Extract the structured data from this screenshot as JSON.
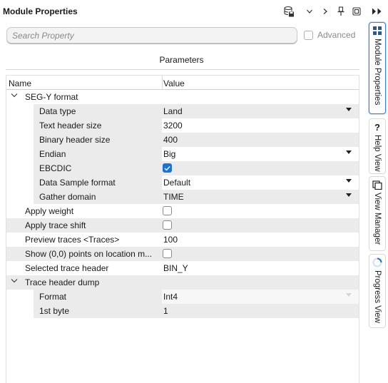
{
  "panel": {
    "title": "Module Properties",
    "search_placeholder": "Search Property",
    "advanced_label": "Advanced",
    "advanced_checked": false,
    "section_title": "Parameters"
  },
  "toolbar_icons": [
    "save-module-icon",
    "chevron-down-icon",
    "chevron-right-icon",
    "pin-icon",
    "popout-icon"
  ],
  "grid": {
    "columns": {
      "name": "Name",
      "value": "Value"
    },
    "rows": [
      {
        "id": "segy-format",
        "label": "SEG-Y format",
        "group": true,
        "expanded": true
      },
      {
        "id": "data-type",
        "label": "Data type",
        "value": "Land",
        "type": "dropdown"
      },
      {
        "id": "text-header-size",
        "label": "Text header size",
        "value": "3200"
      },
      {
        "id": "binary-header-size",
        "label": "Binary header size",
        "value": "400"
      },
      {
        "id": "endian",
        "label": "Endian",
        "value": "Big",
        "type": "dropdown"
      },
      {
        "id": "ebcdic",
        "label": "EBCDIC",
        "type": "checkbox",
        "checked": true
      },
      {
        "id": "data-sample-format",
        "label": "Data Sample format",
        "value": "Default",
        "type": "dropdown"
      },
      {
        "id": "gather-domain",
        "label": "Gather domain",
        "value": "TIME",
        "type": "dropdown"
      },
      {
        "id": "apply-weight",
        "label": "Apply weight",
        "type": "checkbox",
        "checked": false
      },
      {
        "id": "apply-trace-shift",
        "label": "Apply trace shift",
        "type": "checkbox",
        "checked": false
      },
      {
        "id": "preview-traces",
        "label": "Preview traces <Traces>",
        "value": "100"
      },
      {
        "id": "show-points",
        "label": "Show (0,0) points on location m...",
        "type": "checkbox",
        "checked": false
      },
      {
        "id": "selected-trace-header",
        "label": "Selected trace header",
        "value": "BIN_Y"
      },
      {
        "id": "trace-header-dump",
        "label": "Trace header dump",
        "group": true,
        "expanded": true
      },
      {
        "id": "format",
        "label": "Format",
        "value": "Int4",
        "type": "dropdown-disabled"
      },
      {
        "id": "first-byte",
        "label": "1st byte",
        "value": "1"
      }
    ]
  },
  "side_tabs": [
    {
      "label": "Module Properties",
      "icon": "module-properties-icon",
      "active": true
    },
    {
      "label": "Help View",
      "icon": "help-icon",
      "active": false
    },
    {
      "label": "View Manager",
      "icon": "view-manager-icon",
      "active": false
    },
    {
      "label": "Progress View",
      "icon": "progress-icon",
      "active": false
    }
  ],
  "colors": {
    "accent": "#1a73d9",
    "active_tab_border": "#3d7fd6",
    "row_shade": "#ebebeb"
  }
}
